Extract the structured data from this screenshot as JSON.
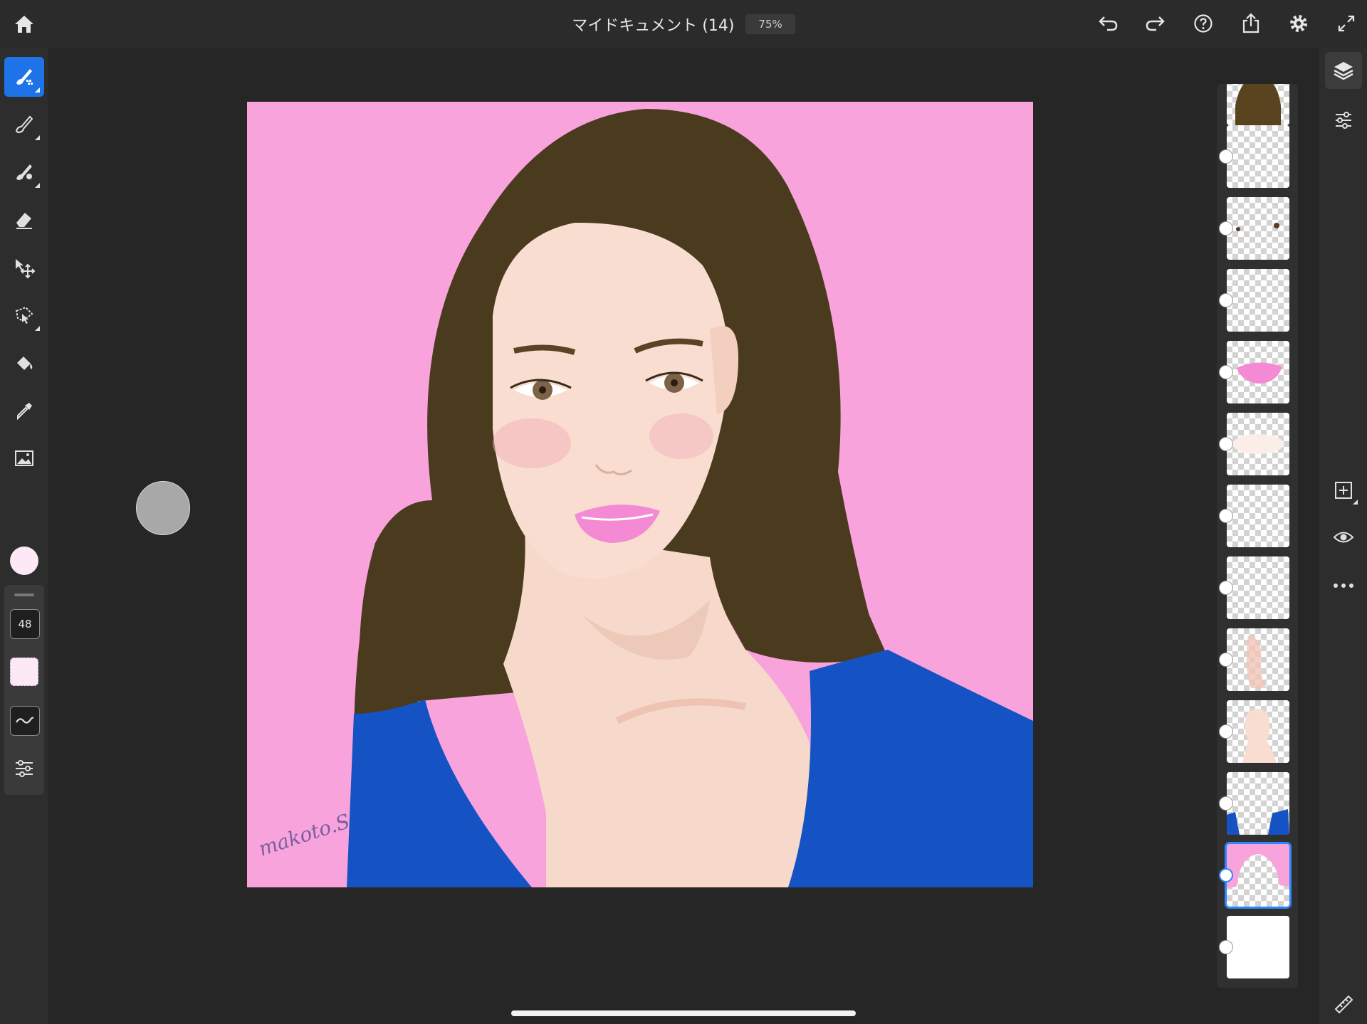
{
  "app": {
    "document_title": "マイドキュメント (14)",
    "zoom": "75%"
  },
  "top_toolbar": {
    "icons": [
      "home-icon",
      "undo-icon",
      "redo-icon",
      "help-icon",
      "share-icon",
      "settings-icon",
      "fullscreen-icon"
    ]
  },
  "left_toolbar": {
    "tools": [
      "paint-brush-icon",
      "pixel-brush-icon",
      "live-brush-icon",
      "eraser-icon",
      "move-transform-icon",
      "selection-icon",
      "fill-icon",
      "eyedropper-icon",
      "place-image-icon"
    ],
    "active_tool": "paint-brush-icon",
    "color": "#fde8f6",
    "brush_size": "48"
  },
  "right_toolbar": {
    "icons": [
      "layers-icon",
      "layer-properties-icon",
      "add-layer-icon",
      "visibility-icon",
      "more-icon",
      "ruler-icon"
    ]
  },
  "layers": {
    "selected_index": 11,
    "items": [
      "hair",
      "empty",
      "eyes",
      "skin-detail",
      "lips",
      "highlight",
      "blush-1",
      "blush-2",
      "shading",
      "face",
      "dress",
      "background",
      "paper"
    ]
  },
  "canvas": {
    "signature": "makoto.S",
    "colors": {
      "background": "#f9a3dc",
      "hair": "#4a3b1f",
      "skin": "#f6d9ca",
      "dress": "#1553c4",
      "lips": "#f48ad4"
    }
  }
}
